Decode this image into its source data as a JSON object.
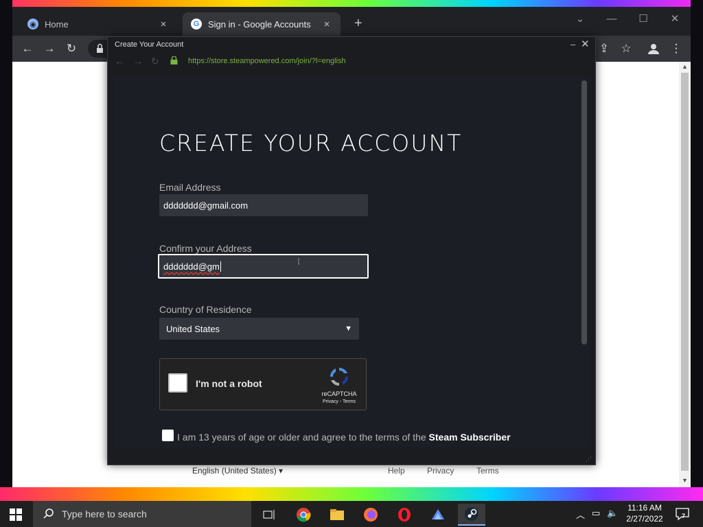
{
  "browser": {
    "tabs": [
      {
        "label": "Home",
        "close": "×"
      },
      {
        "label": "Sign in - Google Accounts",
        "close": "×"
      }
    ],
    "new_tab": "+",
    "controls": {
      "min": "—",
      "max": "☐",
      "close": "✕",
      "chevron": "⌄"
    }
  },
  "page_footer": {
    "language": "English (United States) ▾",
    "links": [
      "Help",
      "Privacy",
      "Terms"
    ]
  },
  "popup": {
    "title": "Create Your Account",
    "url": "https://store.steampowered.com/join/?l=english",
    "min": "–",
    "close": "✕"
  },
  "form": {
    "heading": "CREATE YOUR ACCOUNT",
    "email_label": "Email Address",
    "email_value": "ddddddd@gmail.com",
    "confirm_label": "Confirm your Address",
    "confirm_value": "ddddddd@gm",
    "country_label": "Country of Residence",
    "country_value": "United States",
    "captcha_label": "I'm not a robot",
    "captcha_brand": "reCAPTCHA",
    "captcha_links": "Privacy - Terms",
    "agree_text": "I am 13 years of age or older and agree to the terms of the",
    "agree_link": "Steam Subscriber"
  },
  "taskbar": {
    "search_placeholder": "Type here to search",
    "time": "11:16 AM",
    "date": "2/27/2022",
    "notification_count": "7"
  },
  "colors": {
    "steam_bg": "#1b1e25",
    "input_bg": "#32353c",
    "url_green": "#7cb342",
    "chrome_dark": "#202124"
  }
}
